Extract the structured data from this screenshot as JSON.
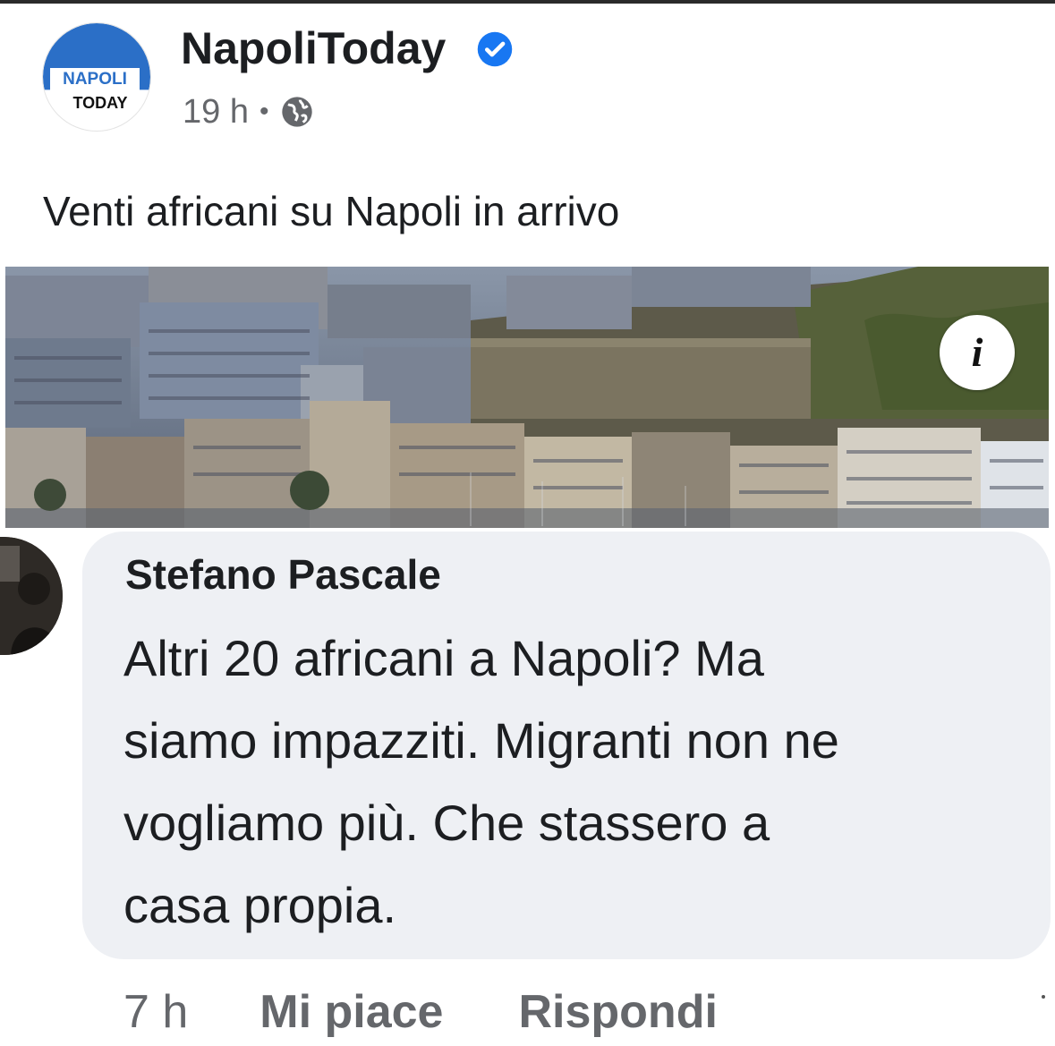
{
  "post": {
    "page_name": "NapoliToday",
    "logo_top": "NAPOLI",
    "logo_bottom": "TODAY",
    "time": "19 h",
    "separator": "•",
    "privacy_icon": "globe-icon",
    "verified_icon": "verified-badge-icon",
    "text": "Venti africani su Napoli in arrivo",
    "preview_info_label": "i"
  },
  "comment": {
    "author": "Stefano Pascale",
    "text": "Altri 20 africani a Napoli? Ma\nsiamo impazziti. Migranti non ne\nvogliamo più. Che stassero a\ncasa propia.",
    "time": "7 h",
    "like_label": "Mi piace",
    "reply_label": "Rispondi"
  },
  "colors": {
    "brand_blue": "#2b6fc7",
    "verified_blue": "#1877f2",
    "secondary_text": "#65676b",
    "bubble_bg": "#eef0f4"
  }
}
